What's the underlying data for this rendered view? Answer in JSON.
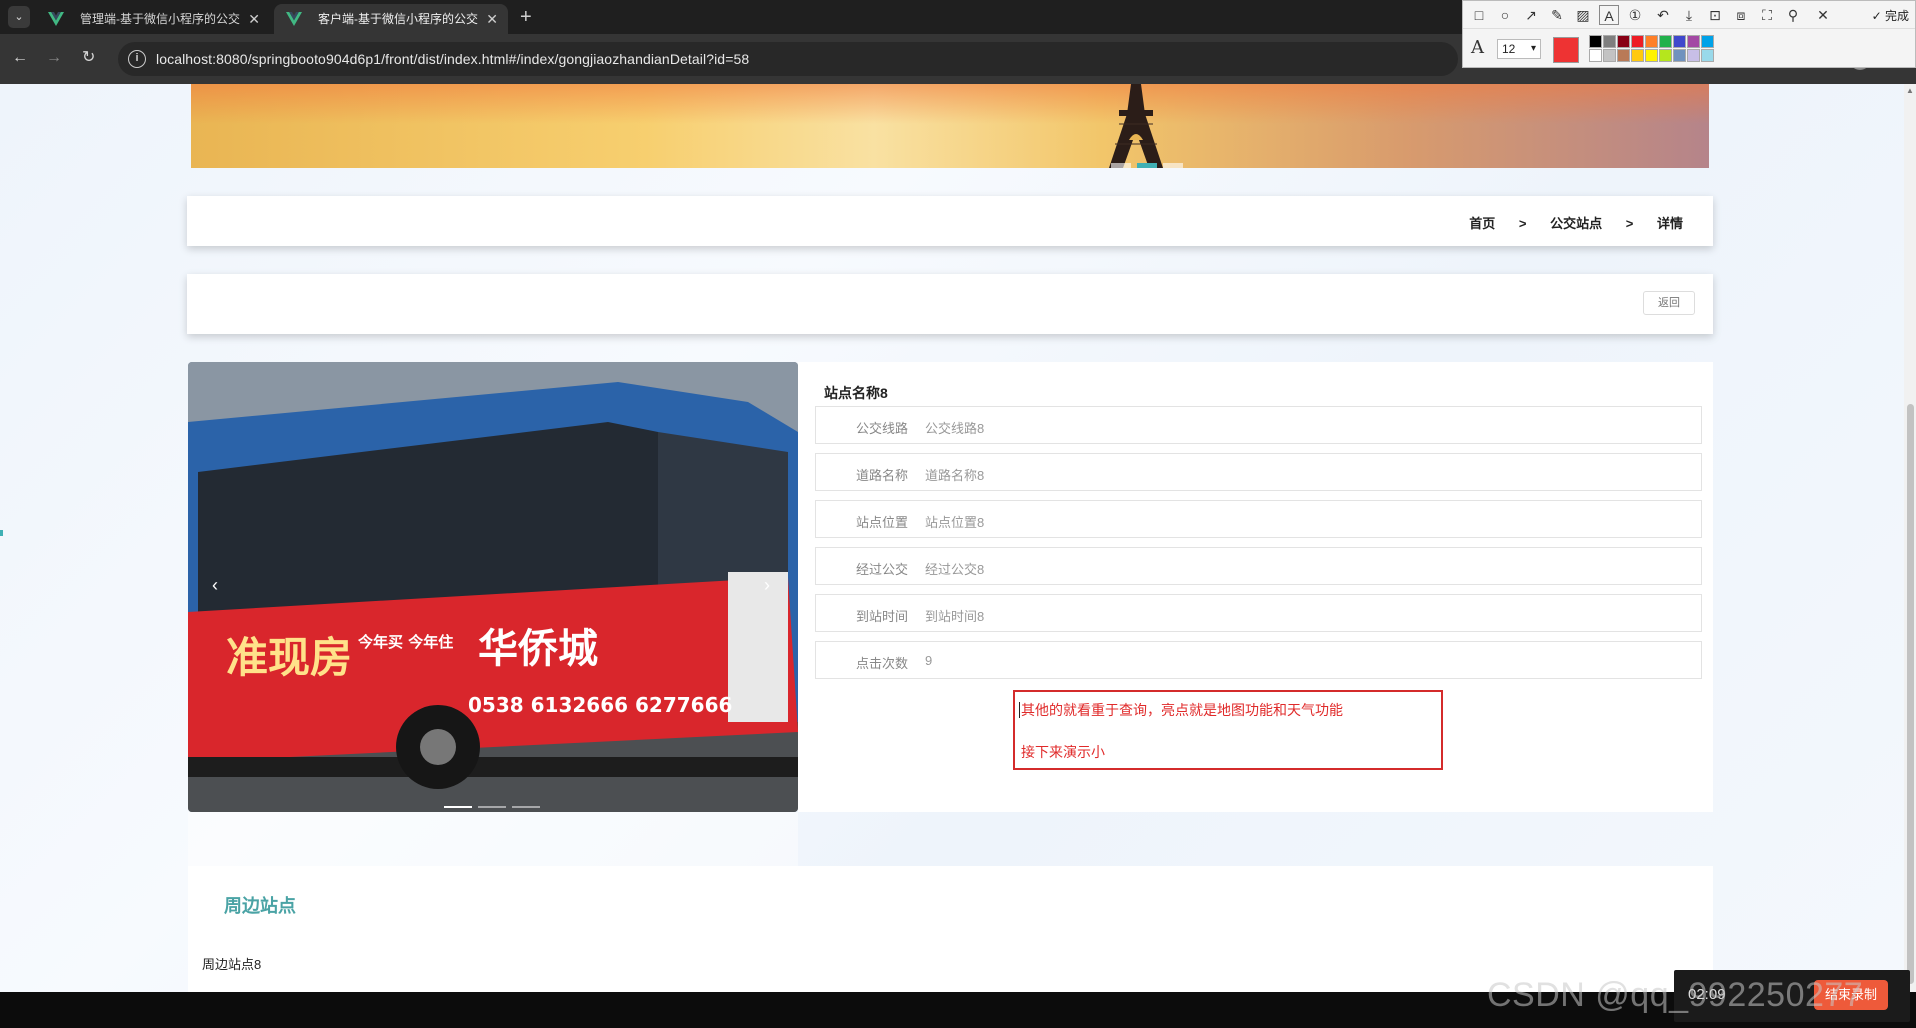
{
  "browser": {
    "tabs": [
      {
        "title": "管理端-基于微信小程序的公交",
        "active": false
      },
      {
        "title": "客户端-基于微信小程序的公交",
        "active": true
      }
    ],
    "url": "localhost:8080/springbooto904d6p1/front/dist/index.html#/index/gongjiaozhandianDetail?id=58"
  },
  "snip_toolbar": {
    "done_label": "完成",
    "font_size": "12",
    "current_color": "#ee3333",
    "palette": [
      "#000000",
      "#7f7f7f",
      "#880015",
      "#ed1c24",
      "#ff7f27",
      "#22b14c",
      "#3f48cc",
      "#a349a4",
      "#00a2e8",
      "#ffffff",
      "#c3c3c3",
      "#b97a57",
      "#ffc90e",
      "#fff200",
      "#b5e61d",
      "#7092be",
      "#c8bfe7",
      "#99d9ea"
    ]
  },
  "breadcrumb": {
    "home": "首页",
    "sep1": ">",
    "section": "公交站点",
    "sep2": ">",
    "current": "详情"
  },
  "back_label": "返回",
  "detail": {
    "station_name": "站点名称8",
    "fields": [
      {
        "label": "公交线路",
        "value": "公交线路8"
      },
      {
        "label": "道路名称",
        "value": "道路名称8"
      },
      {
        "label": "站点位置",
        "value": "站点位置8"
      },
      {
        "label": "经过公交",
        "value": "经过公交8"
      },
      {
        "label": "到站时间",
        "value": "到站时间8"
      },
      {
        "label": "点击次数",
        "value": "9"
      }
    ]
  },
  "annotation": {
    "line1": "其他的就看重于查询，亮点就是地图功能和天气功能",
    "line2": "接下来演示小"
  },
  "photo_ad": {
    "brand": "华侨城",
    "slogan": "准现房",
    "slogan2": "今年买 今年住",
    "phone": "0538 6132666 6277666"
  },
  "nearby": {
    "title": "周边站点",
    "items": [
      "周边站点8"
    ]
  },
  "watermark": "CSDN @qq_992250277",
  "recorder": {
    "time": "02:09",
    "button": "结束录制"
  }
}
